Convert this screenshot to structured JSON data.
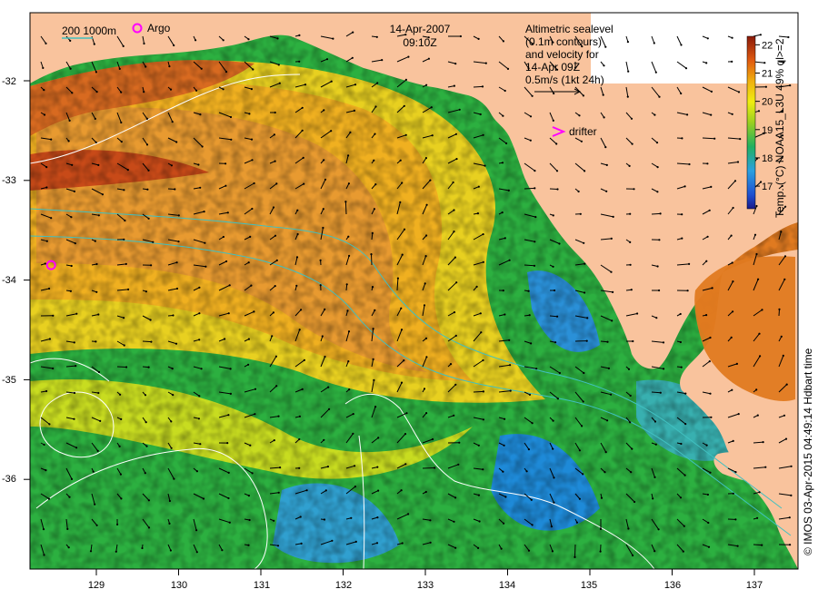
{
  "header": {
    "date": "14-Apr-2007",
    "time": "09:10Z"
  },
  "legend": {
    "isobath_label": "200  1000m",
    "argo_label": "Argo",
    "drifter_label": "drifter",
    "altimetry_lines": [
      "Altimetric sealevel",
      "(0.1m contours)",
      "and velocity for",
      "14-Apr 09Z",
      "0.5m/s (1kt 24h)"
    ]
  },
  "colorbar": {
    "label": "Temp. (°C) NOAA15_L3U 49% ql>=2",
    "ticks": [
      "17",
      "18",
      "19",
      "20",
      "21",
      "22"
    ],
    "min": 16.2,
    "max": 22.3
  },
  "axes": {
    "x_ticks": [
      "129",
      "130",
      "131",
      "132",
      "133",
      "134",
      "135",
      "136",
      "137"
    ],
    "y_ticks": [
      "-32",
      "-33",
      "-34",
      "-35",
      "-36"
    ]
  },
  "credit": "© IMOS 03-Apr-2015 04:49:14 Hdbart time",
  "colors": {
    "land": "#f9c39d",
    "argo_marker": "#ff00ff",
    "drifter_marker": "#ff00ff",
    "isobath_line": "#40c0c0",
    "contour_line": "#ffffff"
  },
  "map_data": {
    "argo_float": {
      "lon": 128.45,
      "lat": -33.85
    }
  }
}
